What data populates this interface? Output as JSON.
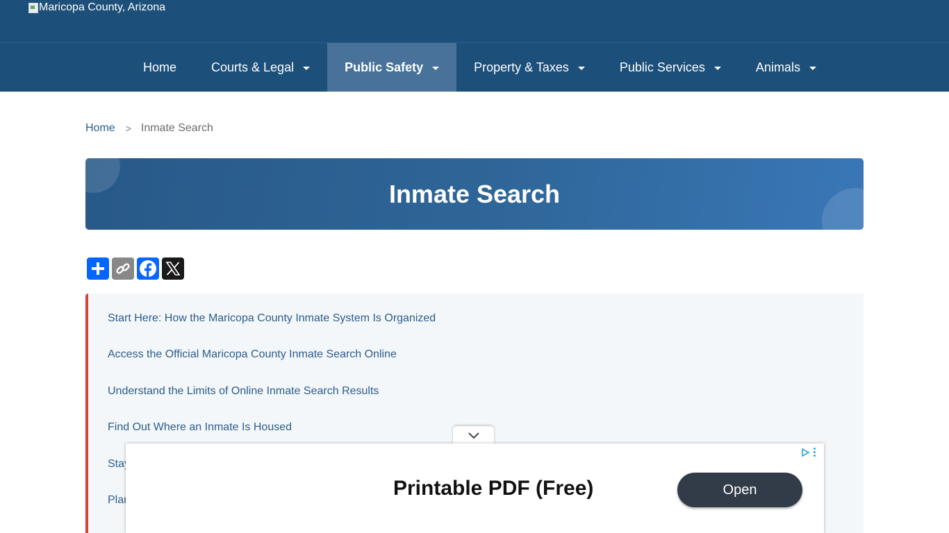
{
  "header": {
    "logo_alt": "Maricopa County, Arizona",
    "brand_color": "#1c4f79"
  },
  "nav": {
    "items": [
      {
        "label": "Home",
        "dropdown": false,
        "active": false
      },
      {
        "label": "Courts & Legal",
        "dropdown": true,
        "active": false
      },
      {
        "label": "Public Safety",
        "dropdown": true,
        "active": true
      },
      {
        "label": "Property & Taxes",
        "dropdown": true,
        "active": false
      },
      {
        "label": "Public Services",
        "dropdown": true,
        "active": false
      },
      {
        "label": "Animals",
        "dropdown": true,
        "active": false
      }
    ]
  },
  "breadcrumb": {
    "home": "Home",
    "separator": ">",
    "current": "Inmate Search"
  },
  "banner": {
    "title": "Inmate Search"
  },
  "share": {
    "buttons": [
      "add-share-icon",
      "copy-link-icon",
      "facebook-icon",
      "x-icon"
    ]
  },
  "toc": {
    "accent_color": "#d6423a",
    "items": [
      "Start Here: How the Maricopa County Inmate System Is Organized",
      "Access the Official Maricopa County Inmate Search Online",
      "Understand the Limits of Online Inmate Search Results",
      "Find Out Where an Inmate Is Housed",
      "Stay",
      "Plan"
    ]
  },
  "ad": {
    "headline": "Printable PDF (Free)",
    "button": "Open",
    "collapse_icon": "chevron-down-icon"
  }
}
